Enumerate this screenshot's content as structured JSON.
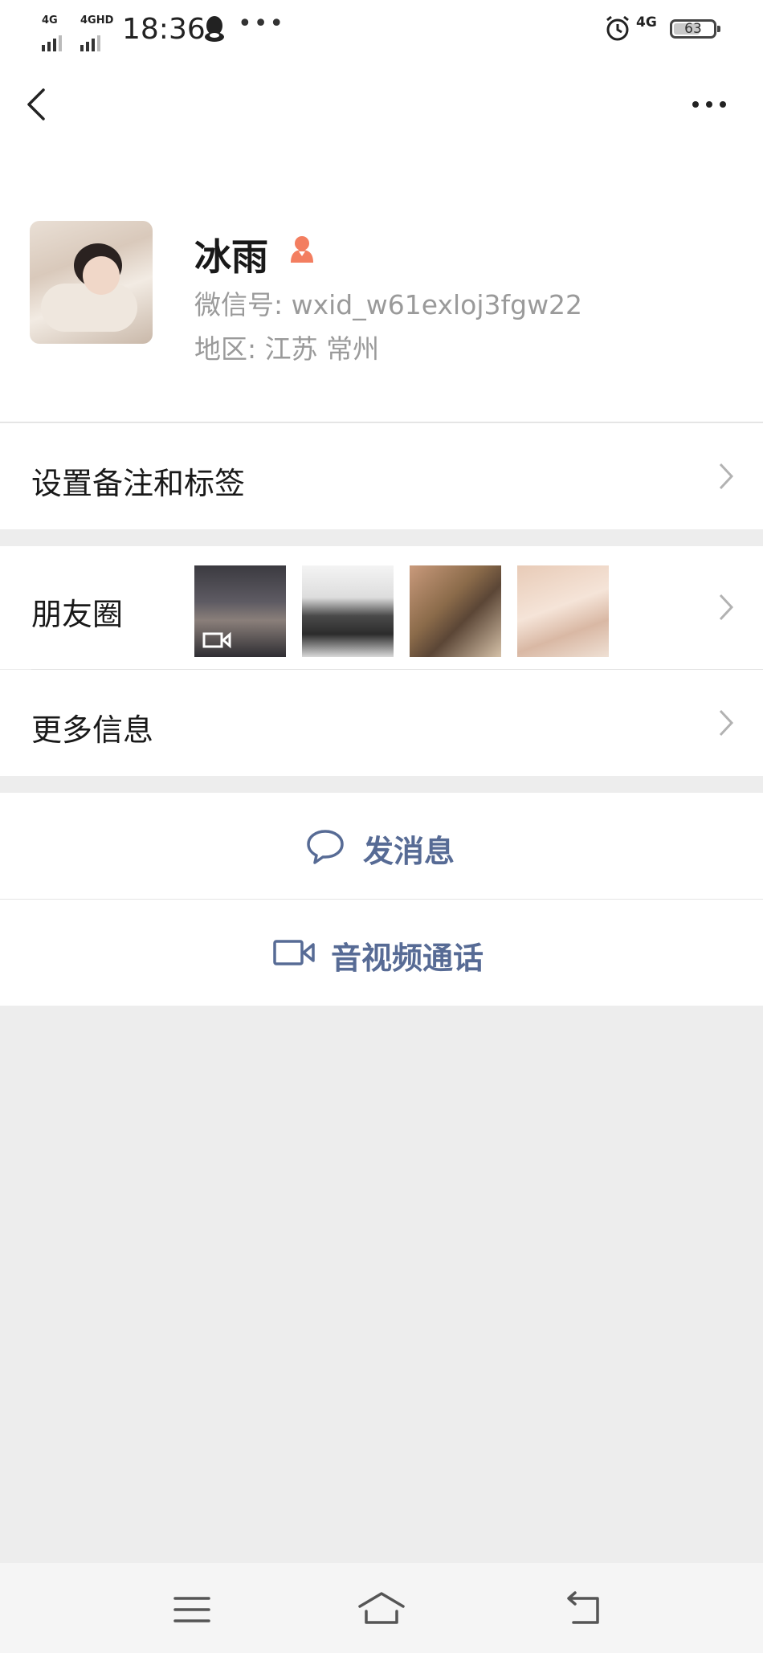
{
  "status_bar": {
    "sim1": "4G",
    "sim2": "4GHD",
    "time": "18:36",
    "network": "4G",
    "battery": "63",
    "icons": [
      "signal-icon",
      "qq-icon",
      "more-notifications-icon",
      "alarm-icon",
      "battery-icon"
    ]
  },
  "nav": {
    "back_icon": "chevron-left-icon",
    "more_icon": "ellipsis-icon"
  },
  "profile": {
    "name": "冰雨",
    "wechat_id": "微信号: wxid_w61exloj3fgw22",
    "region": "地区: 江苏  常州",
    "gender_icon": "female-user-icon",
    "gender_color": "#f37e60"
  },
  "menu": {
    "remark_tags": "设置备注和标签",
    "moments": "朋友圈",
    "more_info": "更多信息"
  },
  "actions": {
    "send_message": "发消息",
    "video_call": "音视频通话",
    "link_color": "#576b95"
  },
  "bottom_nav": {
    "icons": [
      "menu-icon",
      "home-icon",
      "back-icon"
    ]
  }
}
